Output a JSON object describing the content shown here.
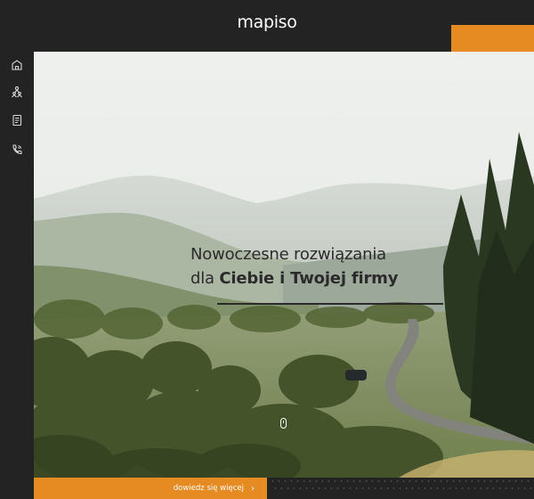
{
  "brand": {
    "logo_text": "mapiso"
  },
  "sidebar": {
    "icons": [
      {
        "name": "home-icon"
      },
      {
        "name": "people-icon"
      },
      {
        "name": "document-icon"
      },
      {
        "name": "phone-icon"
      }
    ]
  },
  "hero": {
    "headline_line1": "Nowoczesne rozwiązania",
    "headline_line2_prefix": "dla ",
    "headline_line2_bold": "Ciebie i Twojej firmy"
  },
  "cta": {
    "label": "dowiedz się więcej",
    "icon": "chevron-right-icon"
  },
  "colors": {
    "accent": "#e68a22",
    "dark": "#232323",
    "headline": "#2b2b2b"
  }
}
